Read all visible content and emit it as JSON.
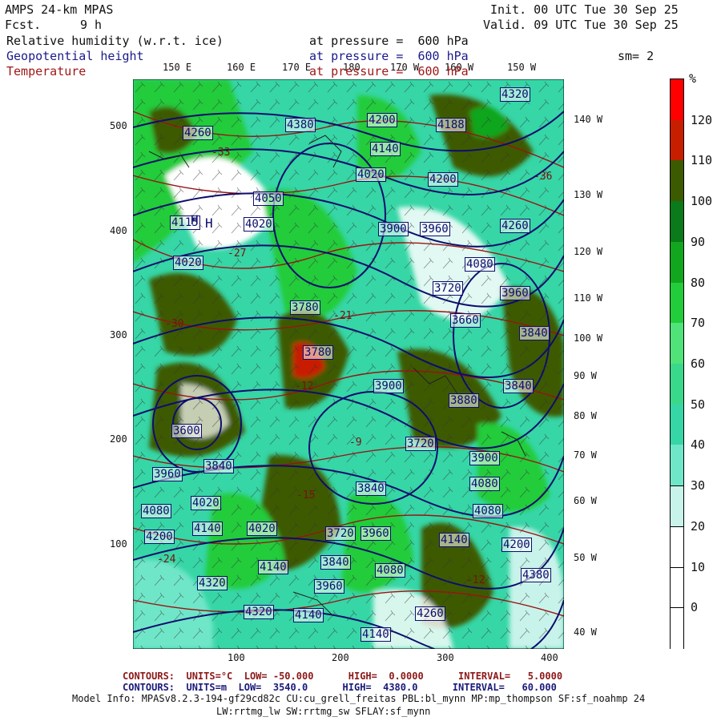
{
  "header": {
    "model": "AMPS 24-km MPAS",
    "fcst_label": "Fcst.",
    "fcst_value": "9 h",
    "init": "Init. 00 UTC Tue 30 Sep 25",
    "valid": "Valid. 09 UTC Tue 30 Sep 25",
    "smoothing": "sm= 2",
    "fields": [
      {
        "name": "Relative humidity (w.r.t. ice)",
        "level": "at pressure =  600 hPa",
        "color": "#111111"
      },
      {
        "name": "Geopotential height",
        "level": "at pressure =  600 hPa",
        "color": "#1a1a8c"
      },
      {
        "name": "Temperature",
        "level": "at pressure =  600 hPa",
        "color": "#a01818"
      }
    ]
  },
  "map": {
    "top_lon_labels": [
      "150 E",
      "160 E",
      "170 E",
      "180",
      "170 W",
      "160 W",
      "150 W"
    ],
    "right_lon_labels": [
      "140 W",
      "130 W",
      "120 W",
      "110 W",
      "100 W",
      "90 W",
      "80 W",
      "70 W",
      "60 W",
      "50 W",
      "40 W"
    ],
    "x_ticks": [
      "100",
      "200",
      "300",
      "400"
    ],
    "y_ticks": [
      "500",
      "400",
      "300",
      "200",
      "100"
    ],
    "height_labels": [
      "4200",
      "4260",
      "4380",
      "4200",
      "4140",
      "4200",
      "4188",
      "4320",
      "4260",
      "4020",
      "4050",
      "3900",
      "3960",
      "4020",
      "4260",
      "4115",
      "4020",
      "4080",
      "3780",
      "4080",
      "3960",
      "4020",
      "3720",
      "3900",
      "3660",
      "3840",
      "3600",
      "3840",
      "3780",
      "3840",
      "3900",
      "3880",
      "3720",
      "4080",
      "3960",
      "3900",
      "4020",
      "4080",
      "3840",
      "4140",
      "4200",
      "4140",
      "4020",
      "3720",
      "3960",
      "4140",
      "4200",
      "4320",
      "3840",
      "4080",
      "4380",
      "4140",
      "3960",
      "4320",
      "4140",
      "4260"
    ],
    "temp_labels": [
      "-27",
      "-30",
      "-21",
      "-12",
      "-9",
      "-24",
      "-15",
      "-18",
      "-12",
      "-36",
      "-33"
    ],
    "high_marks": [
      "H",
      "H"
    ]
  },
  "colorbar": {
    "unit": "%",
    "labels": [
      "120",
      "110",
      "100",
      "90",
      "80",
      "70",
      "60",
      "50",
      "40",
      "30",
      "20",
      "10",
      "0"
    ],
    "colors": [
      "#ff0000",
      "#c81e00",
      "#3c5a00",
      "#0a7a1a",
      "#11a61e",
      "#22cc3a",
      "#4fe37a",
      "#3ad88a",
      "#36d6a6",
      "#6fe6c8",
      "#c8f3ea",
      "#ffffff",
      "#ffffff",
      "#ffffff"
    ]
  },
  "footer": {
    "temp_contours": "CONTOURS:  UNITS=°C  LOW= -50.000      HIGH=  0.0000      INTERVAL=   5.0000",
    "height_contours": "CONTOURS:  UNITS=m  LOW=  3540.0      HIGH=  4380.0      INTERVAL=   60.000",
    "model_info": "Model Info: MPASv8.2.3-194-gf29cd82c CU:cu_grell_freitas PBL:bl_mynn MP:mp_thompson SF:sf_noahmp 24",
    "model_info_2": "LW:rrtmg_lw SW:rrtmg_sw SFLAY:sf_mynn"
  }
}
